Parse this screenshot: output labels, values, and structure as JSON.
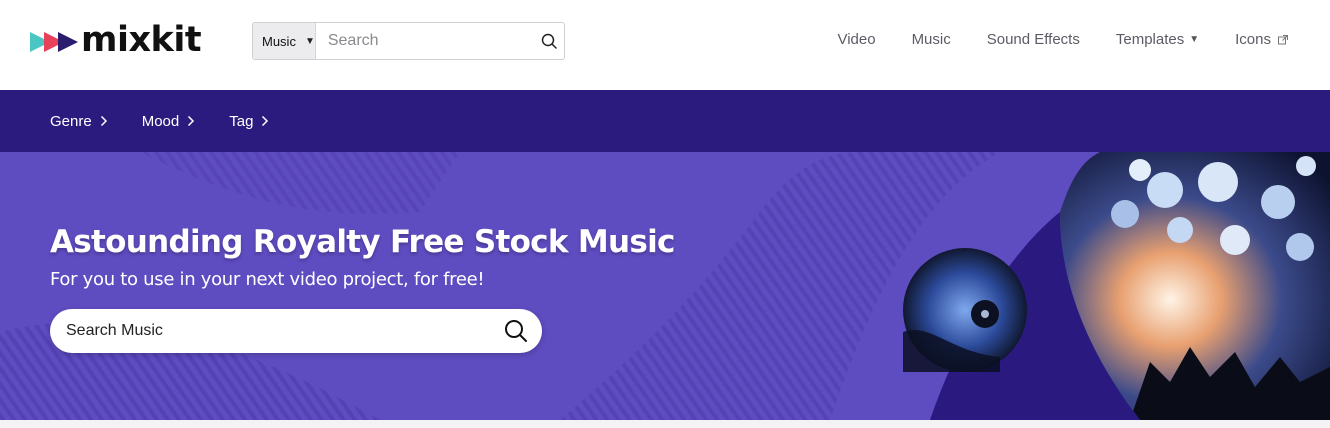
{
  "header": {
    "logo_text": "mixkit",
    "search": {
      "category": "Music",
      "placeholder": "Search"
    },
    "nav": [
      {
        "label": "Video"
      },
      {
        "label": "Music"
      },
      {
        "label": "Sound Effects"
      },
      {
        "label": "Templates"
      },
      {
        "label": "Icons"
      }
    ]
  },
  "categories": [
    {
      "label": "Genre"
    },
    {
      "label": "Mood"
    },
    {
      "label": "Tag"
    }
  ],
  "hero": {
    "title": "Astounding Royalty Free Stock Music",
    "subtitle": "For you to use in your next video project, for free!",
    "search_placeholder": "Search Music"
  },
  "colors": {
    "header_bg": "#ffffff",
    "category_bar": "#2c1b7e",
    "hero_bg": "#5e4cc1",
    "hero_accent": "#2a1a80"
  },
  "icons": {
    "search": "search-icon",
    "chevron": "chevron-right-icon",
    "caret": "caret-down-icon",
    "external": "external-link-icon"
  }
}
